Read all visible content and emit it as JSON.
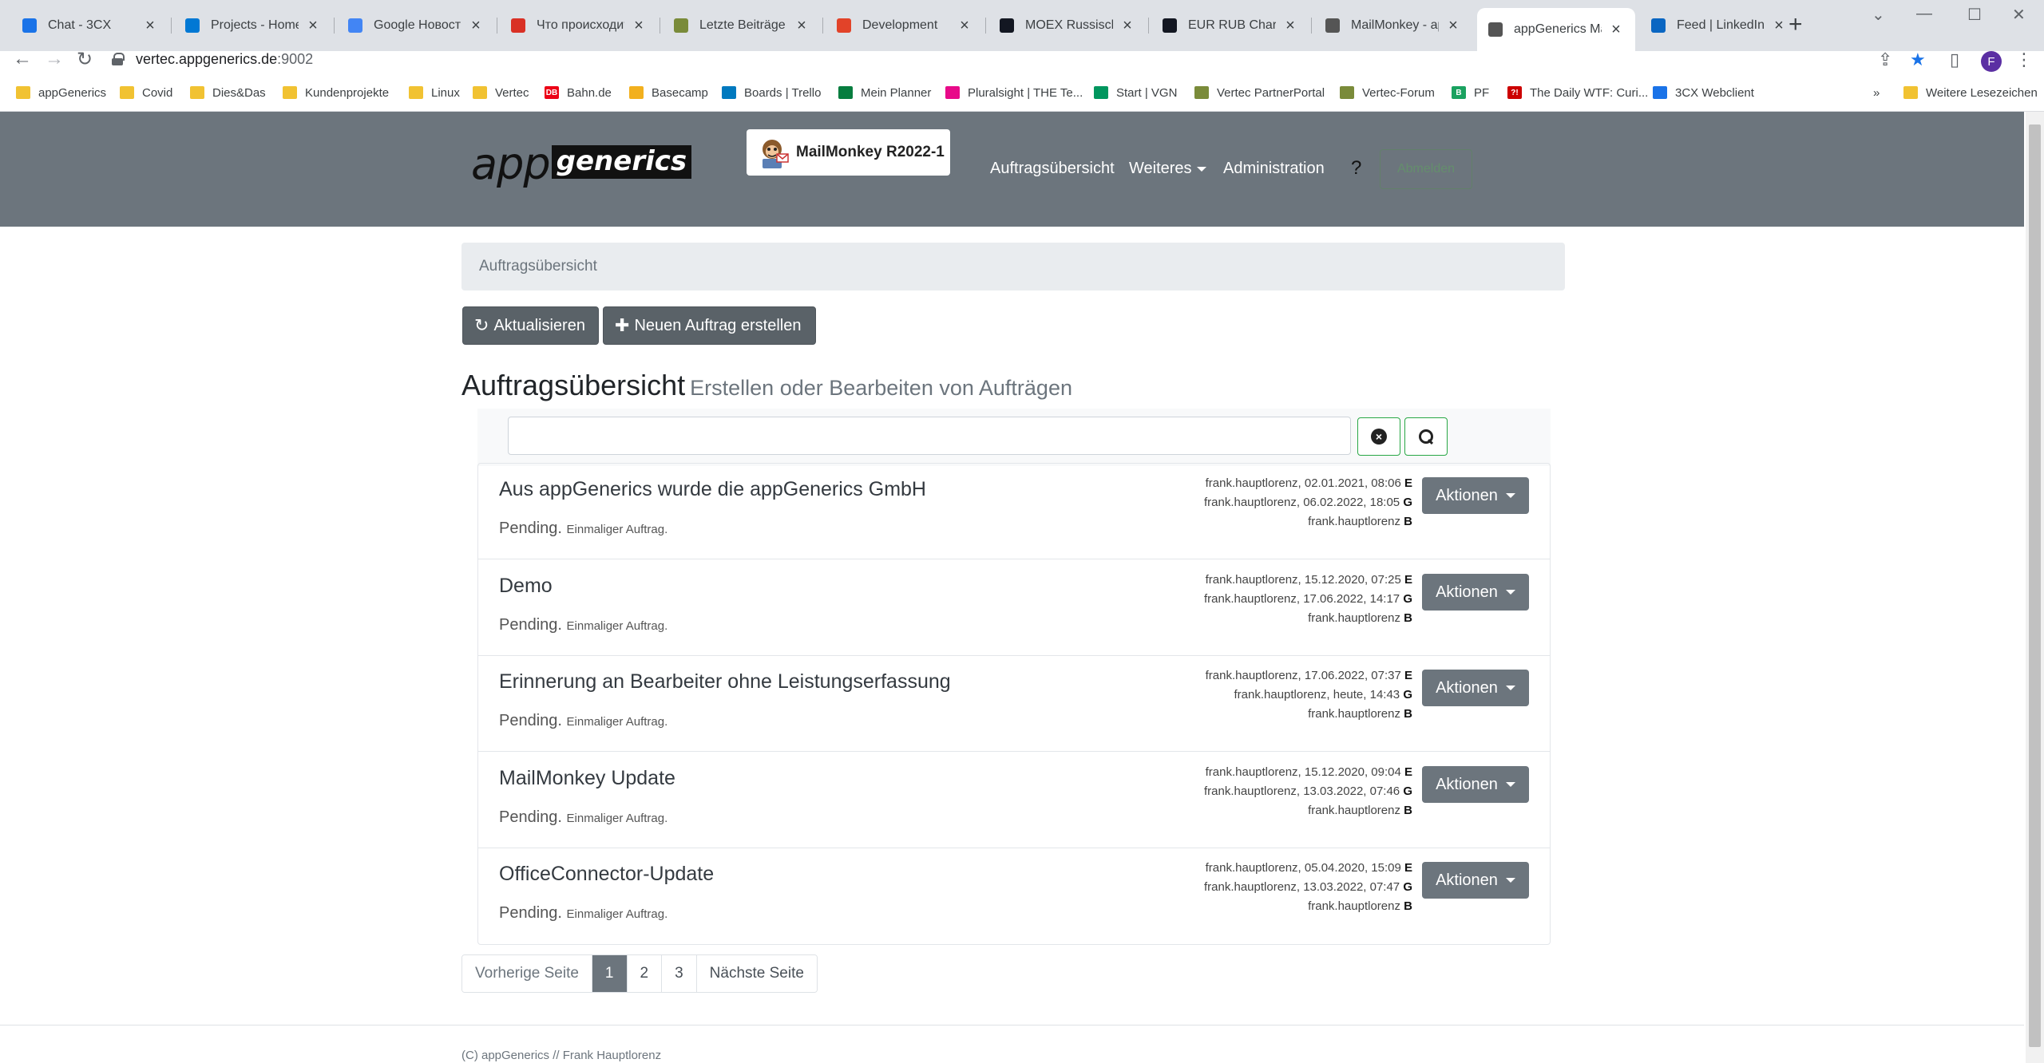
{
  "browser": {
    "tabs": [
      {
        "title": "Chat - 3CX",
        "icon": "3cx-icon",
        "color": "#1a73e8"
      },
      {
        "title": "Projects - Home",
        "icon": "azure-devops-icon",
        "color": "#0078d4"
      },
      {
        "title": "Google Новости",
        "icon": "google-news-icon",
        "color": "#4285f4"
      },
      {
        "title": "Что происходит н",
        "icon": "red-circle-icon",
        "color": "#d93025"
      },
      {
        "title": "Letzte Beiträge - V",
        "icon": "vertec-icon",
        "color": "#7a8b3a"
      },
      {
        "title": "Development",
        "icon": "gitlab-icon",
        "color": "#e24329"
      },
      {
        "title": "MOEX Russischer I",
        "icon": "tradingview-icon",
        "color": "#131722"
      },
      {
        "title": "EUR RUB Chart - E",
        "icon": "tradingview-icon",
        "color": "#131722"
      },
      {
        "title": "MailMonkey - app",
        "icon": "mailmonkey-icon",
        "color": "#555555"
      },
      {
        "title": "appGenerics Maili",
        "icon": "mailmonkey-icon",
        "color": "#555555",
        "active": true
      },
      {
        "title": "Feed | LinkedIn",
        "icon": "linkedin-icon",
        "color": "#0a66c2"
      }
    ],
    "url_host": "vertec.appgenerics.de",
    "url_port": ":9002",
    "profile_initial": "F",
    "bookmarks": [
      {
        "label": "appGenerics",
        "type": "folder"
      },
      {
        "label": "Covid",
        "type": "folder"
      },
      {
        "label": "Dies&Das",
        "type": "folder"
      },
      {
        "label": "Kundenprojekte",
        "type": "folder"
      },
      {
        "label": "Linux",
        "type": "folder"
      },
      {
        "label": "Vertec",
        "type": "folder"
      },
      {
        "label": "Bahn.de",
        "type": "site",
        "icon_text": "DB",
        "color": "#ec0016"
      },
      {
        "label": "Basecamp",
        "type": "site",
        "color": "#f2b01e"
      },
      {
        "label": "Boards | Trello",
        "type": "site",
        "color": "#0079bf"
      },
      {
        "label": "Mein Planner",
        "type": "site",
        "color": "#077d3f"
      },
      {
        "label": "Pluralsight | THE Te...",
        "type": "site",
        "color": "#e80a89"
      },
      {
        "label": "Start | VGN",
        "type": "site",
        "color": "#00965e"
      },
      {
        "label": "Vertec PartnerPortal",
        "type": "site",
        "color": "#7a8b3a"
      },
      {
        "label": "Vertec-Forum",
        "type": "site",
        "color": "#7a8b3a"
      },
      {
        "label": "PF",
        "type": "site",
        "icon_text": "B",
        "color": "#1aa260"
      },
      {
        "label": "The Daily WTF: Curi...",
        "type": "site",
        "icon_text": "?!",
        "color": "#cc0000"
      },
      {
        "label": "3CX Webclient",
        "type": "site",
        "color": "#1a73e8"
      }
    ],
    "bookmarks_more": "»",
    "other_bookmarks": "Weitere Lesezeichen"
  },
  "app": {
    "logo_app": "app",
    "logo_generics": "generics",
    "brand": "MailMonkey R2022-1",
    "nav": {
      "overview": "Auftragsübersicht",
      "more": "Weiteres",
      "admin": "Administration",
      "help": "?",
      "ghost": "Abmelden"
    },
    "breadcrumb": "Auftragsübersicht",
    "buttons": {
      "refresh": "Aktualisieren",
      "new_job": "Neuen Auftrag erstellen"
    },
    "title": "Auftragsübersicht",
    "subtitle": "Erstellen oder Bearbeiten von Aufträgen",
    "search": {
      "value": "",
      "placeholder": ""
    },
    "jobs": [
      {
        "title": "Aus appGenerics wurde die appGenerics GmbH",
        "status": "Pending.",
        "type": "Einmaliger Auftrag.",
        "created": "frank.hauptlorenz, 02.01.2021, 08:06",
        "created_flag": "E",
        "changed": "frank.hauptlorenz, 06.02.2022, 18:05",
        "changed_flag": "G",
        "editor": "frank.hauptlorenz",
        "editor_flag": "B",
        "actions": "Aktionen"
      },
      {
        "title": "Demo",
        "status": "Pending.",
        "type": "Einmaliger Auftrag.",
        "created": "frank.hauptlorenz, 15.12.2020, 07:25",
        "created_flag": "E",
        "changed": "frank.hauptlorenz, 17.06.2022, 14:17",
        "changed_flag": "G",
        "editor": "frank.hauptlorenz",
        "editor_flag": "B",
        "actions": "Aktionen"
      },
      {
        "title": "Erinnerung an Bearbeiter ohne Leistungserfassung",
        "status": "Pending.",
        "type": "Einmaliger Auftrag.",
        "created": "frank.hauptlorenz, 17.06.2022, 07:37",
        "created_flag": "E",
        "changed": "frank.hauptlorenz, heute, 14:43",
        "changed_flag": "G",
        "editor": "frank.hauptlorenz",
        "editor_flag": "B",
        "actions": "Aktionen"
      },
      {
        "title": "MailMonkey Update",
        "status": "Pending.",
        "type": "Einmaliger Auftrag.",
        "created": "frank.hauptlorenz, 15.12.2020, 09:04",
        "created_flag": "E",
        "changed": "frank.hauptlorenz, 13.03.2022, 07:46",
        "changed_flag": "G",
        "editor": "frank.hauptlorenz",
        "editor_flag": "B",
        "actions": "Aktionen"
      },
      {
        "title": "OfficeConnector-Update",
        "status": "Pending.",
        "type": "Einmaliger Auftrag.",
        "created": "frank.hauptlorenz, 05.04.2020, 15:09",
        "created_flag": "E",
        "changed": "frank.hauptlorenz, 13.03.2022, 07:47",
        "changed_flag": "G",
        "editor": "frank.hauptlorenz",
        "editor_flag": "B",
        "actions": "Aktionen"
      }
    ],
    "pagination": {
      "prev": "Vorherige Seite",
      "pages": [
        "1",
        "2",
        "3"
      ],
      "current": "1",
      "next": "Nächste Seite"
    },
    "footer": "(C) appGenerics // Frank Hauptlorenz"
  }
}
